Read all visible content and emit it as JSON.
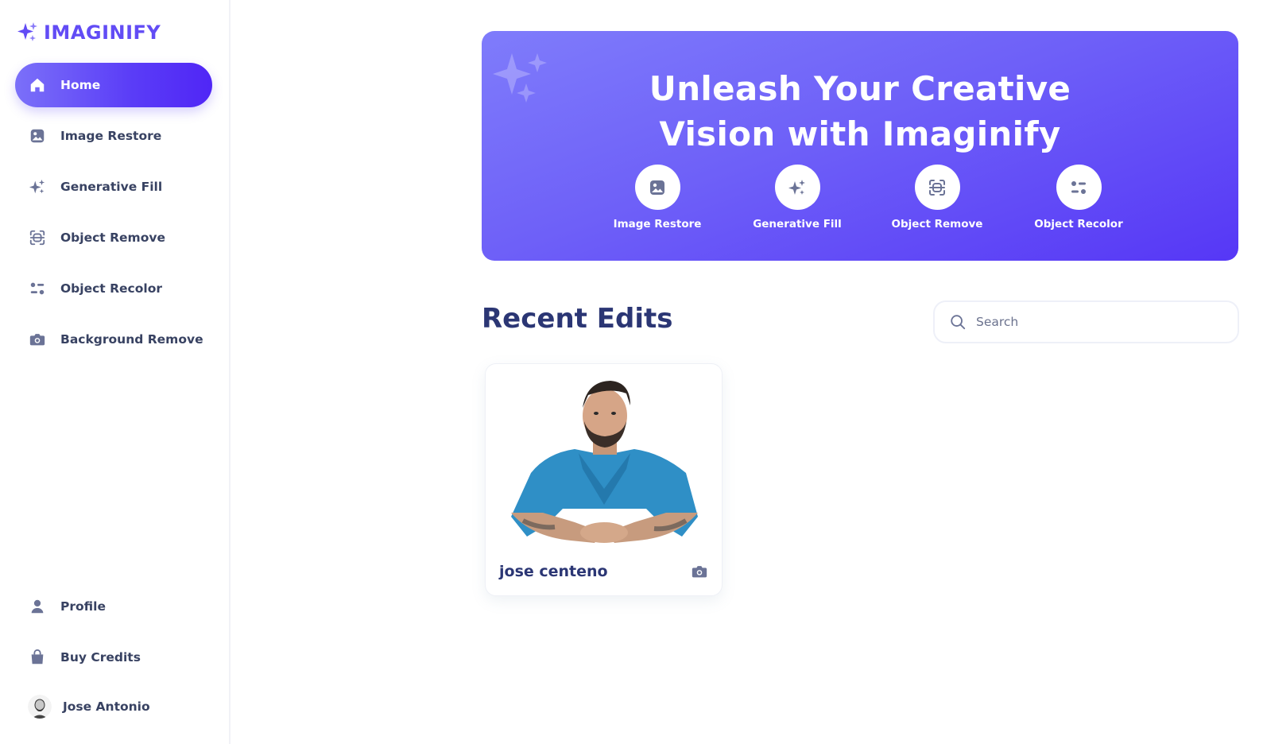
{
  "app": {
    "name": "IMAGINIFY",
    "brand_color": "#624cf5"
  },
  "sidebar": {
    "items": [
      {
        "label": "Home",
        "icon": "home-icon",
        "active": true
      },
      {
        "label": "Image Restore",
        "icon": "image-icon"
      },
      {
        "label": "Generative Fill",
        "icon": "sparkles-icon"
      },
      {
        "label": "Object Remove",
        "icon": "scan-icon"
      },
      {
        "label": "Object Recolor",
        "icon": "filter-icon"
      },
      {
        "label": "Background Remove",
        "icon": "camera-icon"
      }
    ],
    "bottom_items": [
      {
        "label": "Profile",
        "icon": "user-icon"
      },
      {
        "label": "Buy Credits",
        "icon": "bag-icon"
      }
    ],
    "user": {
      "name": "Jose Antonio"
    }
  },
  "banner": {
    "title_line1": "Unleash Your Creative",
    "title_line2": "Vision with Imaginify",
    "links": [
      {
        "label": "Image Restore",
        "icon": "image-icon"
      },
      {
        "label": "Generative Fill",
        "icon": "sparkles-icon"
      },
      {
        "label": "Object Remove",
        "icon": "scan-icon"
      },
      {
        "label": "Object Recolor",
        "icon": "filter-icon"
      }
    ]
  },
  "recent": {
    "title": "Recent Edits",
    "search_placeholder": "Search",
    "cards": [
      {
        "title": "jose centeno",
        "type_icon": "camera-icon"
      }
    ]
  }
}
